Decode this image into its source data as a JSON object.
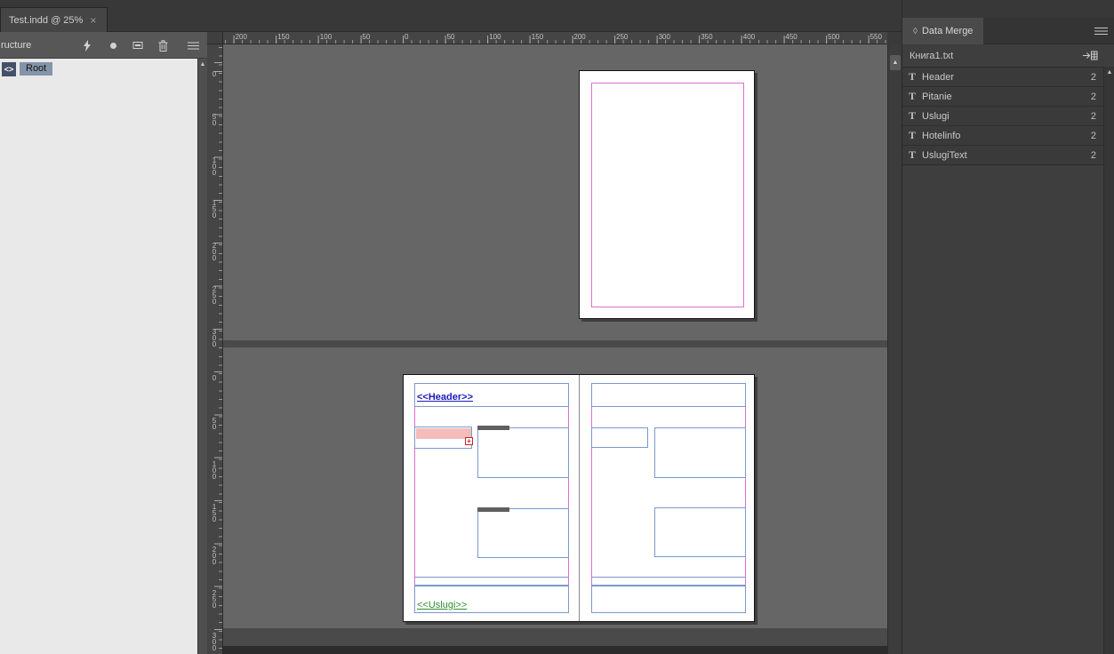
{
  "colors": {
    "margin_guide": "#df6ed2",
    "frame_edge": "#7a99cc",
    "header_text": "#1a1ab8",
    "uslugi_text": "#2f8f2f",
    "field_highlight": "#f5bcbc",
    "overset_red": "#cc2222",
    "gray_bar": "#5f5f5f",
    "selection": "#8495aa"
  },
  "tab_bar": {
    "document_tab": "Test.indd @ 25%",
    "close_glyph": "×"
  },
  "structure_panel": {
    "title": "ructure",
    "root_icon_glyph": "<>",
    "root_label": "Root"
  },
  "rulers": {
    "horizontal": [
      "200",
      "150",
      "100",
      "50",
      "0",
      "50",
      "100",
      "150",
      "200",
      "250",
      "300",
      "350",
      "400",
      "450",
      "500",
      "550"
    ],
    "vertical_top": [
      "0",
      "50",
      "100",
      "150",
      "200",
      "250",
      "300"
    ],
    "vertical_bottom": [
      "0",
      "50",
      "100",
      "150",
      "200",
      "250",
      "300"
    ]
  },
  "document": {
    "header_placeholder": "<<Header>>",
    "uslugi_placeholder": "<<Uslugi>>",
    "overset_glyph": "+"
  },
  "data_merge_panel": {
    "tab_icon": "◊",
    "tab_label": "Data Merge",
    "source_file": "Книга1.txt",
    "fields": [
      {
        "type_glyph": "T",
        "name": "Header",
        "count": "2"
      },
      {
        "type_glyph": "T",
        "name": "Pitanie",
        "count": "2"
      },
      {
        "type_glyph": "T",
        "name": "Uslugi",
        "count": "2"
      },
      {
        "type_glyph": "T",
        "name": "Hotelinfo",
        "count": "2"
      },
      {
        "type_glyph": "T",
        "name": "UslugiText",
        "count": "2"
      }
    ]
  },
  "scroll": {
    "up_glyph": "▲"
  }
}
